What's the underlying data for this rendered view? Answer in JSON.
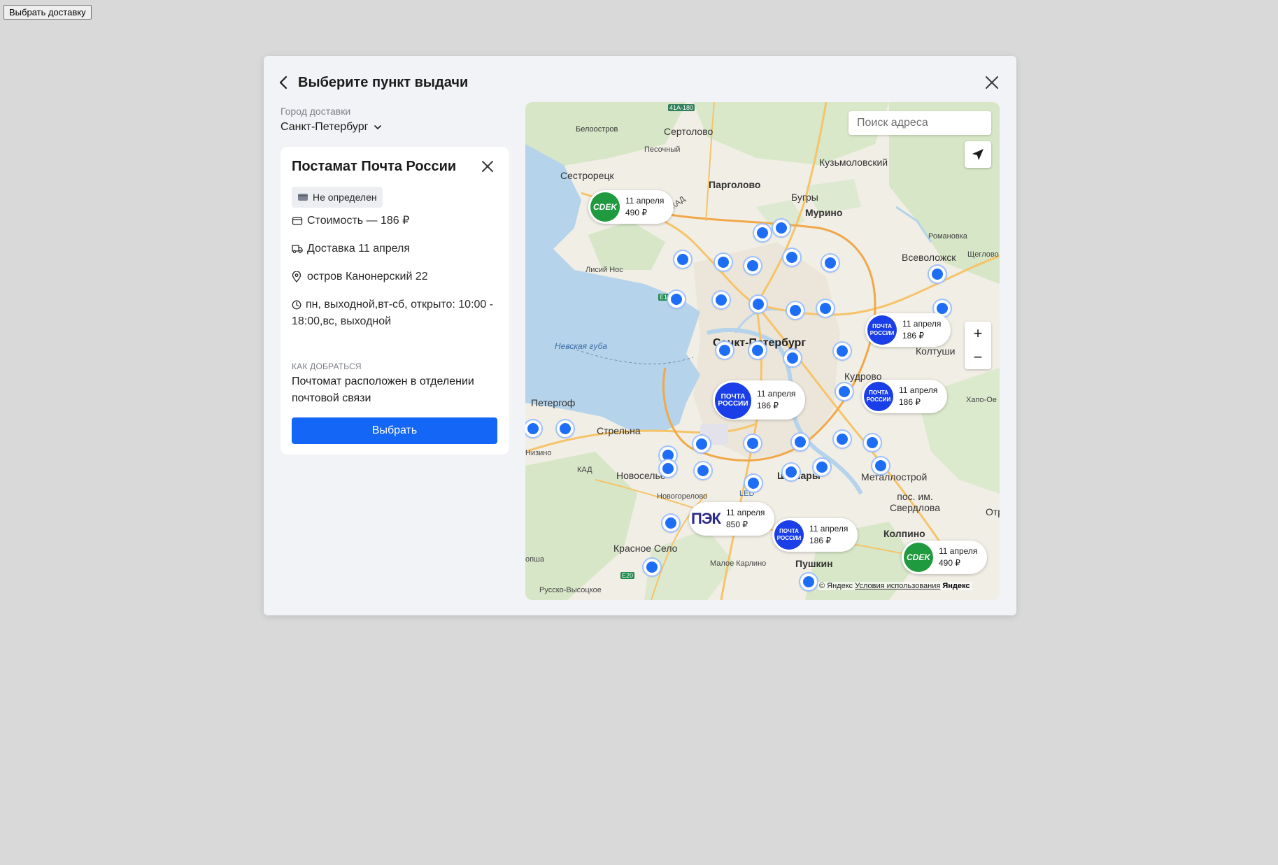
{
  "open_button": "Выбрать доставку",
  "modal": {
    "title": "Выберите пункт выдачи",
    "city_label": "Город доставки",
    "city_value": "Санкт-Петербург"
  },
  "card": {
    "title": "Постамат Почта России",
    "badge": "Не определен",
    "cost": "Стоимость — 186 ₽",
    "delivery": "Доставка 11 апреля",
    "address": "остров Канонерский 22",
    "hours": "пн, выходной,вт-сб, открыто: 10:00 - 18:00,вс, выходной",
    "how_label": "КАК ДОБРАТЬСЯ",
    "how_text": "Почтомат расположен в отделении почтовой связи",
    "select_button": "Выбрать"
  },
  "map": {
    "search_placeholder": "Поиск адреса",
    "zoom_in": "+",
    "zoom_out": "−",
    "labels": {
      "sertolovo": "Сертолово",
      "beloostrov": "Белоостров",
      "pesochny": "Песочный",
      "sestroretsk": "Сестрорецк",
      "pargolovo": "Парголово",
      "bugry": "Бугры",
      "murino": "Мурино",
      "kuzmolovsky": "Кузьмоловский",
      "romanovka": "Романовка",
      "vsevolozhsk": "Всеволожск",
      "shcheglovo": "Щеглово",
      "lisiy_nos": "Лисий Нос",
      "spb": "Санкт-Петербург",
      "nevskaya_guba": "Невская губа",
      "koltushi": "Колтуши",
      "kudrovo": "Кудрово",
      "yanino": "Хапо-Ое",
      "peterhof": "Петергоф",
      "strelna": "Стрельна",
      "novoselye": "Новоселье",
      "shushary": "Шушары",
      "metallostroy": "Металлострой",
      "sverdlova": "пос. им. Свердлова",
      "novogorelovo": "Новогорелово",
      "kolpino": "Колпино",
      "krasnoe_selo": "Красное Село",
      "maloe_karlino": "Малое Карлино",
      "pushkin": "Пушкин",
      "russko_vysotskoe": "Русско-Высоцкое",
      "izino": "Низино",
      "led": "LED",
      "kad1": "КАД",
      "kad2": "КАД",
      "a180": "41A-180",
      "e18": "E18",
      "e20": "E20",
      "otr": "Отр",
      "ropsha": "опша"
    },
    "pins": [
      {
        "carrier": "СDEK",
        "date": "11 апреля",
        "price": "490 ₽"
      },
      {
        "carrier": "ПОЧТА РОССИИ",
        "date": "11 апреля",
        "price": "186 ₽"
      },
      {
        "carrier": "ПОЧТА РОССИИ",
        "date": "11 апреля",
        "price": "186 ₽"
      },
      {
        "carrier": "ПОЧТА РОССИИ",
        "date": "11 апреля",
        "price": "186 ₽"
      },
      {
        "carrier": "ПЭК",
        "date": "11 апреля",
        "price": "850 ₽"
      },
      {
        "carrier": "ПОЧТА РОССИИ",
        "date": "11 апреля",
        "price": "186 ₽"
      },
      {
        "carrier": "СDEK",
        "date": "11 апреля",
        "price": "490 ₽"
      }
    ],
    "copyright": "© Яндекс",
    "terms": "Условия использования",
    "brand": "Яндекс"
  },
  "colors": {
    "accent": "#1366f6",
    "dot": "#1e6ef5",
    "cdek": "#1f9a3e",
    "post": "#1a3ee8",
    "water": "#b5d3ea"
  }
}
